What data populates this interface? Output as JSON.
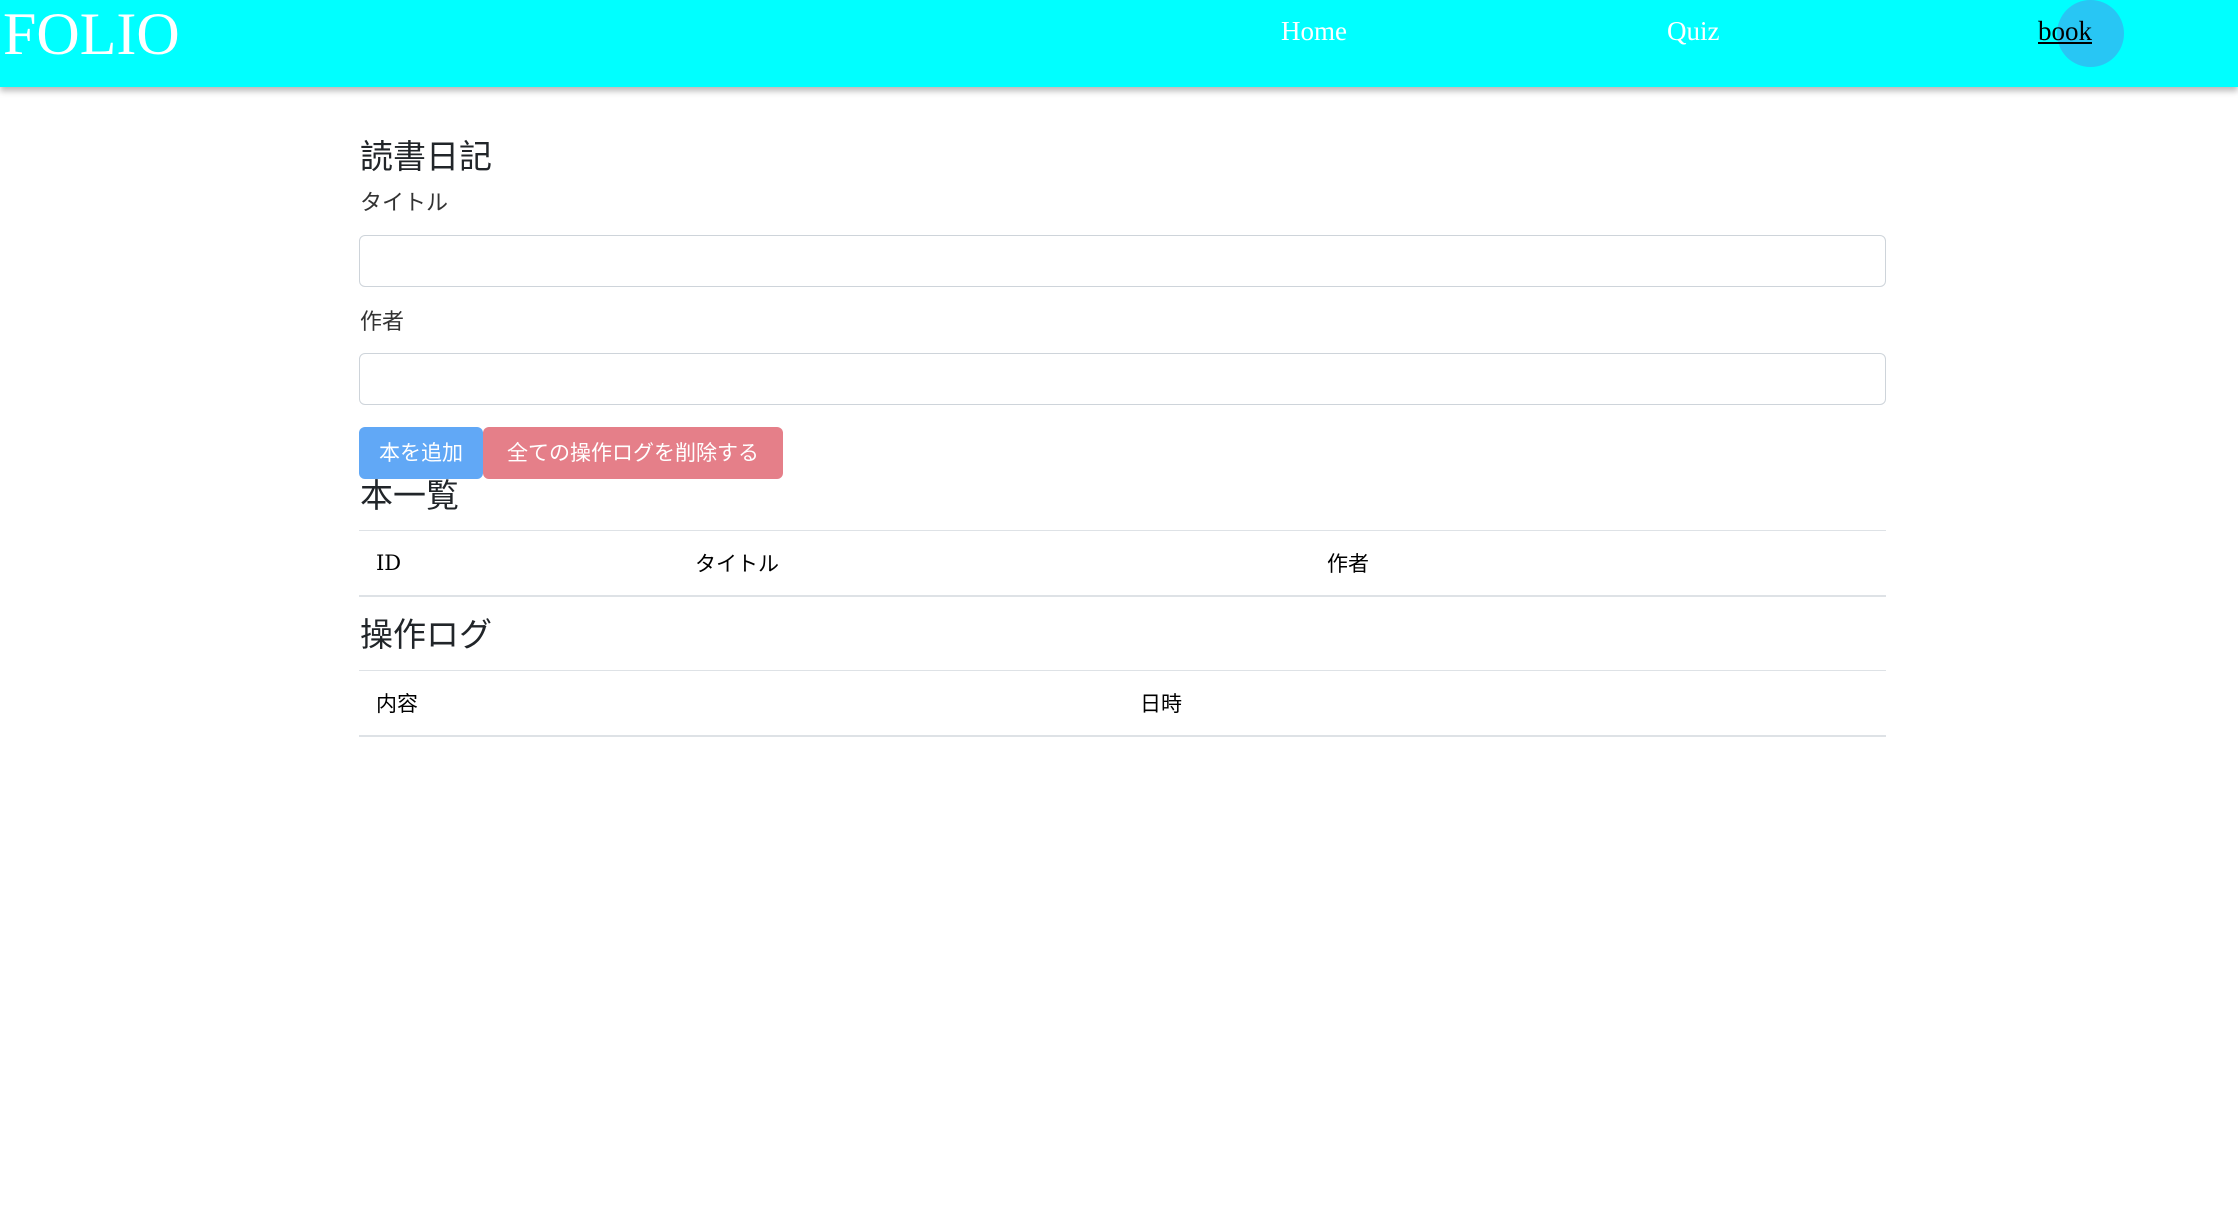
{
  "navbar": {
    "brand": "FOLIO",
    "links": [
      {
        "label": "Home"
      },
      {
        "label": "Quiz"
      },
      {
        "label": "book"
      }
    ]
  },
  "form": {
    "heading": "読書日記",
    "title_label": "タイトル",
    "title_value": "",
    "author_label": "作者",
    "author_value": "",
    "add_button": "本を追加",
    "delete_logs_button": "全ての操作ログを削除する"
  },
  "book_list": {
    "heading": "本一覧",
    "columns": [
      "ID",
      "タイトル",
      "作者"
    ],
    "rows": []
  },
  "operation_log": {
    "heading": "操作ログ",
    "columns": [
      "内容",
      "日時"
    ],
    "rows": []
  },
  "colors": {
    "navbar": "#00ffff",
    "primary_button": "#61a8f6",
    "danger_button": "#e57f89",
    "active_nav_bubble": "#2fbcf2"
  }
}
